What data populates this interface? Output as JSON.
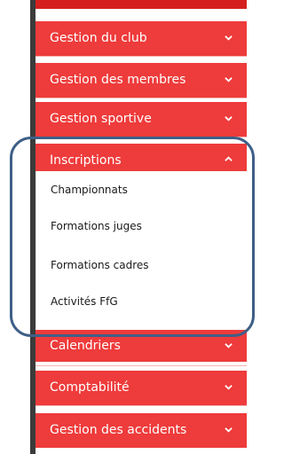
{
  "menu": {
    "items": [
      {
        "label": "Gestion du club",
        "expanded": false
      },
      {
        "label": "Gestion des membres",
        "expanded": false
      },
      {
        "label": "Gestion sportive",
        "expanded": false
      },
      {
        "label": "Inscriptions",
        "expanded": true
      },
      {
        "label": "Calendriers",
        "expanded": false
      },
      {
        "label": "Comptabilité",
        "expanded": false
      },
      {
        "label": "Gestion des accidents",
        "expanded": false
      }
    ],
    "submenu": [
      {
        "label": "Championnats"
      },
      {
        "label": "Formations juges"
      },
      {
        "label": "Formations cadres"
      },
      {
        "label": "Activités FfG"
      }
    ]
  },
  "colors": {
    "menu_background": "#ee3b3b",
    "menu_text": "#ffffff",
    "submenu_background": "#ffffff",
    "submenu_text": "#1a1a1a",
    "highlight_outline": "#3f5f87"
  },
  "icons": {
    "collapsed": "chevron-down-icon",
    "expanded": "chevron-up-icon"
  }
}
